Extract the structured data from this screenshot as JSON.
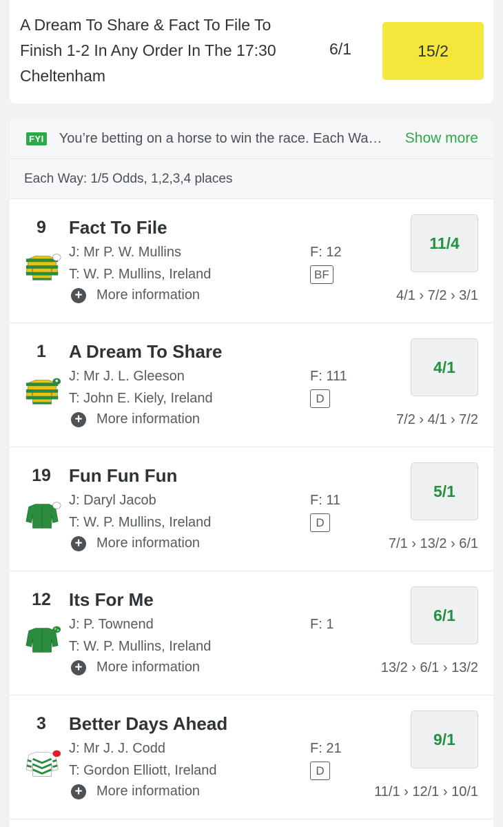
{
  "bet_offer": {
    "title": "A Dream To Share & Fact To File To Finish 1-2 In Any Order In The 17:30 Cheltenham",
    "old_odds": "6/1",
    "boosted_odds": "15/2"
  },
  "fyi": {
    "badge": "FYI",
    "text": "You’re betting on a horse to win the race. Each Wa…",
    "show_more": "Show more"
  },
  "each_way": "Each Way: 1/5 Odds, 1,2,3,4 places",
  "runners": [
    {
      "number": "9",
      "name": "Fact To File",
      "jockey": "J: Mr P. W. Mullins",
      "trainer": "T: W. P. Mullins, Ireland",
      "more": "More information",
      "form": "F: 12",
      "badge": "BF",
      "price": "11/4",
      "history": "4/1 › 7/2 › 3/1",
      "silk": "green-gold-hoops-icon"
    },
    {
      "number": "1",
      "name": "A Dream To Share",
      "jockey": "J: Mr J. L. Gleeson",
      "trainer": "T: John E. Kiely, Ireland",
      "more": "More information",
      "form": "F: 111",
      "badge": "D",
      "price": "4/1",
      "history": "7/2 › 4/1 › 7/2",
      "silk": "green-gold-hoops-green-cap-icon"
    },
    {
      "number": "19",
      "name": "Fun Fun Fun",
      "jockey": "J: Daryl Jacob",
      "trainer": "T: W. P. Mullins, Ireland",
      "more": "More information",
      "form": "F: 11",
      "badge": "D",
      "price": "5/1",
      "history": "7/1 › 13/2 › 6/1",
      "silk": "green-silk-icon"
    },
    {
      "number": "12",
      "name": "Its For Me",
      "jockey": "J: P. Townend",
      "trainer": "T: W. P. Mullins, Ireland",
      "more": "More information",
      "form": "F: 1",
      "badge": "",
      "price": "6/1",
      "history": "13/2 › 6/1 › 13/2",
      "silk": "green-silk-spotted-cap-icon"
    },
    {
      "number": "3",
      "name": "Better Days Ahead",
      "jockey": "J: Mr J. J. Codd",
      "trainer": "T: Gordon Elliott, Ireland",
      "more": "More information",
      "form": "F: 21",
      "badge": "D",
      "price": "9/1",
      "history": "11/1 › 12/1 › 10/1",
      "silk": "white-green-chevrons-red-cap-icon"
    }
  ],
  "colors": {
    "accent_green": "#2ea84a",
    "price_green": "#23913f",
    "boost_yellow": "#f5e63c",
    "silk_green": "#2a8c3c",
    "silk_gold": "#e6c21b",
    "cap_red": "#e02020"
  }
}
